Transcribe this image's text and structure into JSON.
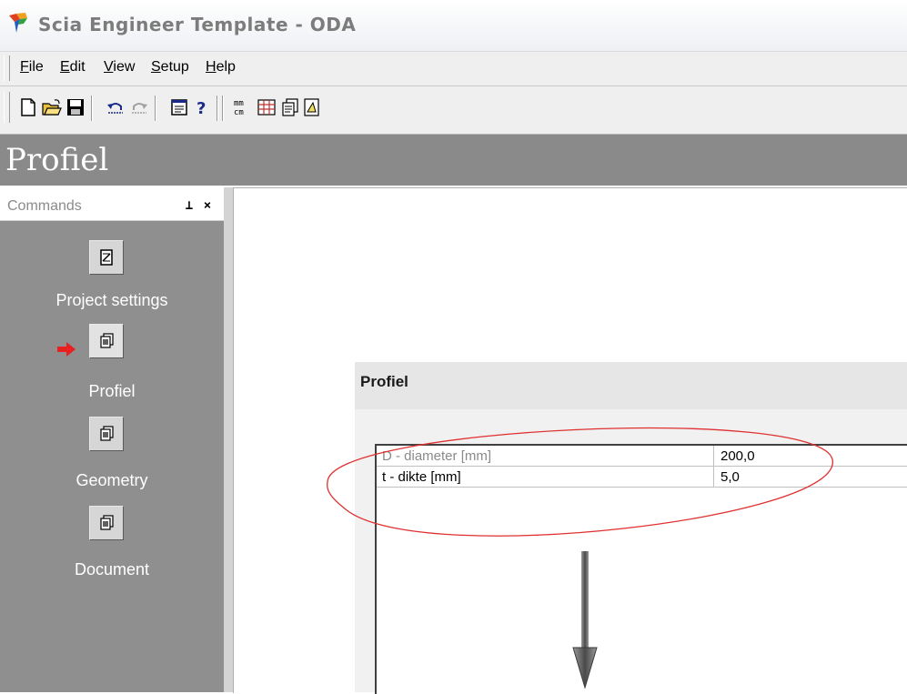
{
  "window": {
    "title": "Scia Engineer Template - ODA"
  },
  "menu": {
    "items": [
      {
        "label": "File",
        "accel": "F",
        "rest": "ile"
      },
      {
        "label": "Edit",
        "accel": "E",
        "rest": "dit"
      },
      {
        "label": "View",
        "accel": "V",
        "rest": "iew"
      },
      {
        "label": "Setup",
        "accel": "S",
        "rest": "etup"
      },
      {
        "label": "Help",
        "accel": "H",
        "rest": "elp"
      }
    ]
  },
  "toolbar": {
    "buttons": [
      "new-file-icon",
      "open-folder-icon",
      "save-icon",
      "undo-icon",
      "redo-icon",
      "properties-icon",
      "help-icon",
      "units-icon",
      "table-icon",
      "copy-pages-icon",
      "document-icon"
    ],
    "units_label": "mm\ncm",
    "help_label": "?"
  },
  "header": {
    "title": "Profiel"
  },
  "commands": {
    "title": "Commands",
    "pin_label": "⊥",
    "close_label": "×",
    "items": [
      {
        "label": "Project settings",
        "icon": "settings-document-icon",
        "active": false
      },
      {
        "label": "Profiel",
        "icon": "layers-icon",
        "active": true
      },
      {
        "label": "Geometry",
        "icon": "layers-icon",
        "active": false
      },
      {
        "label": "Document",
        "icon": "layers-icon",
        "active": false
      }
    ]
  },
  "dialog": {
    "title": "Profiel",
    "rows": [
      {
        "label": "D - diameter [mm]",
        "value": "200,0",
        "label_color": "#8a8a8a"
      },
      {
        "label": "t - dikte [mm]",
        "value": "5,0",
        "label_color": "#000000"
      }
    ]
  },
  "colors": {
    "annotation_red": "#e03030",
    "panel_gray": "#8f8f8f",
    "header_gray": "#8a8a8a"
  }
}
